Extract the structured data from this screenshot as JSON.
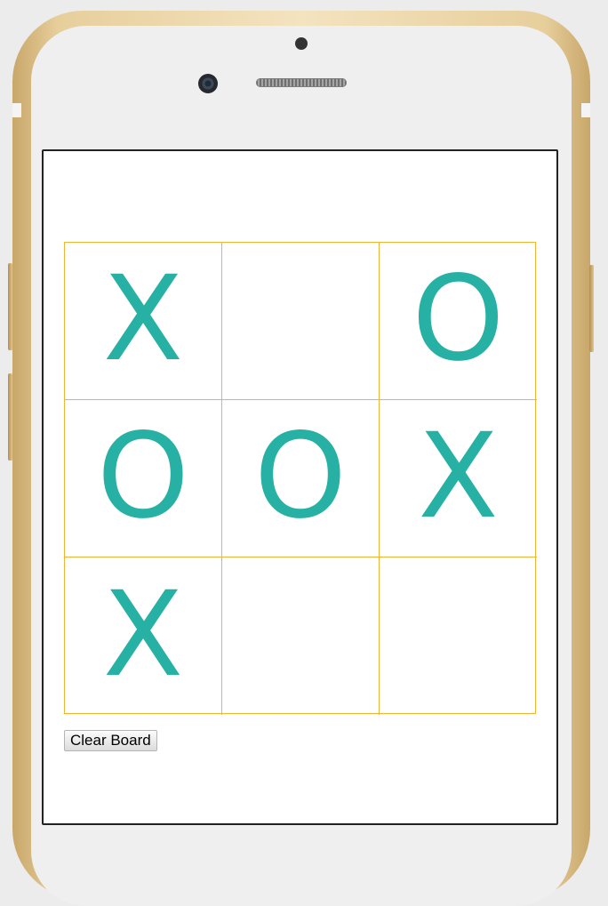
{
  "game": {
    "board": [
      [
        "X",
        "",
        "O"
      ],
      [
        "O",
        "O",
        "X"
      ],
      [
        "X",
        "",
        ""
      ]
    ],
    "clear_button_label": "Clear Board"
  },
  "colors": {
    "mark": "#27b1a4",
    "grid_line": "#f2b233",
    "phone_frame": "#e7cf9c",
    "page_background": "#ececec"
  }
}
